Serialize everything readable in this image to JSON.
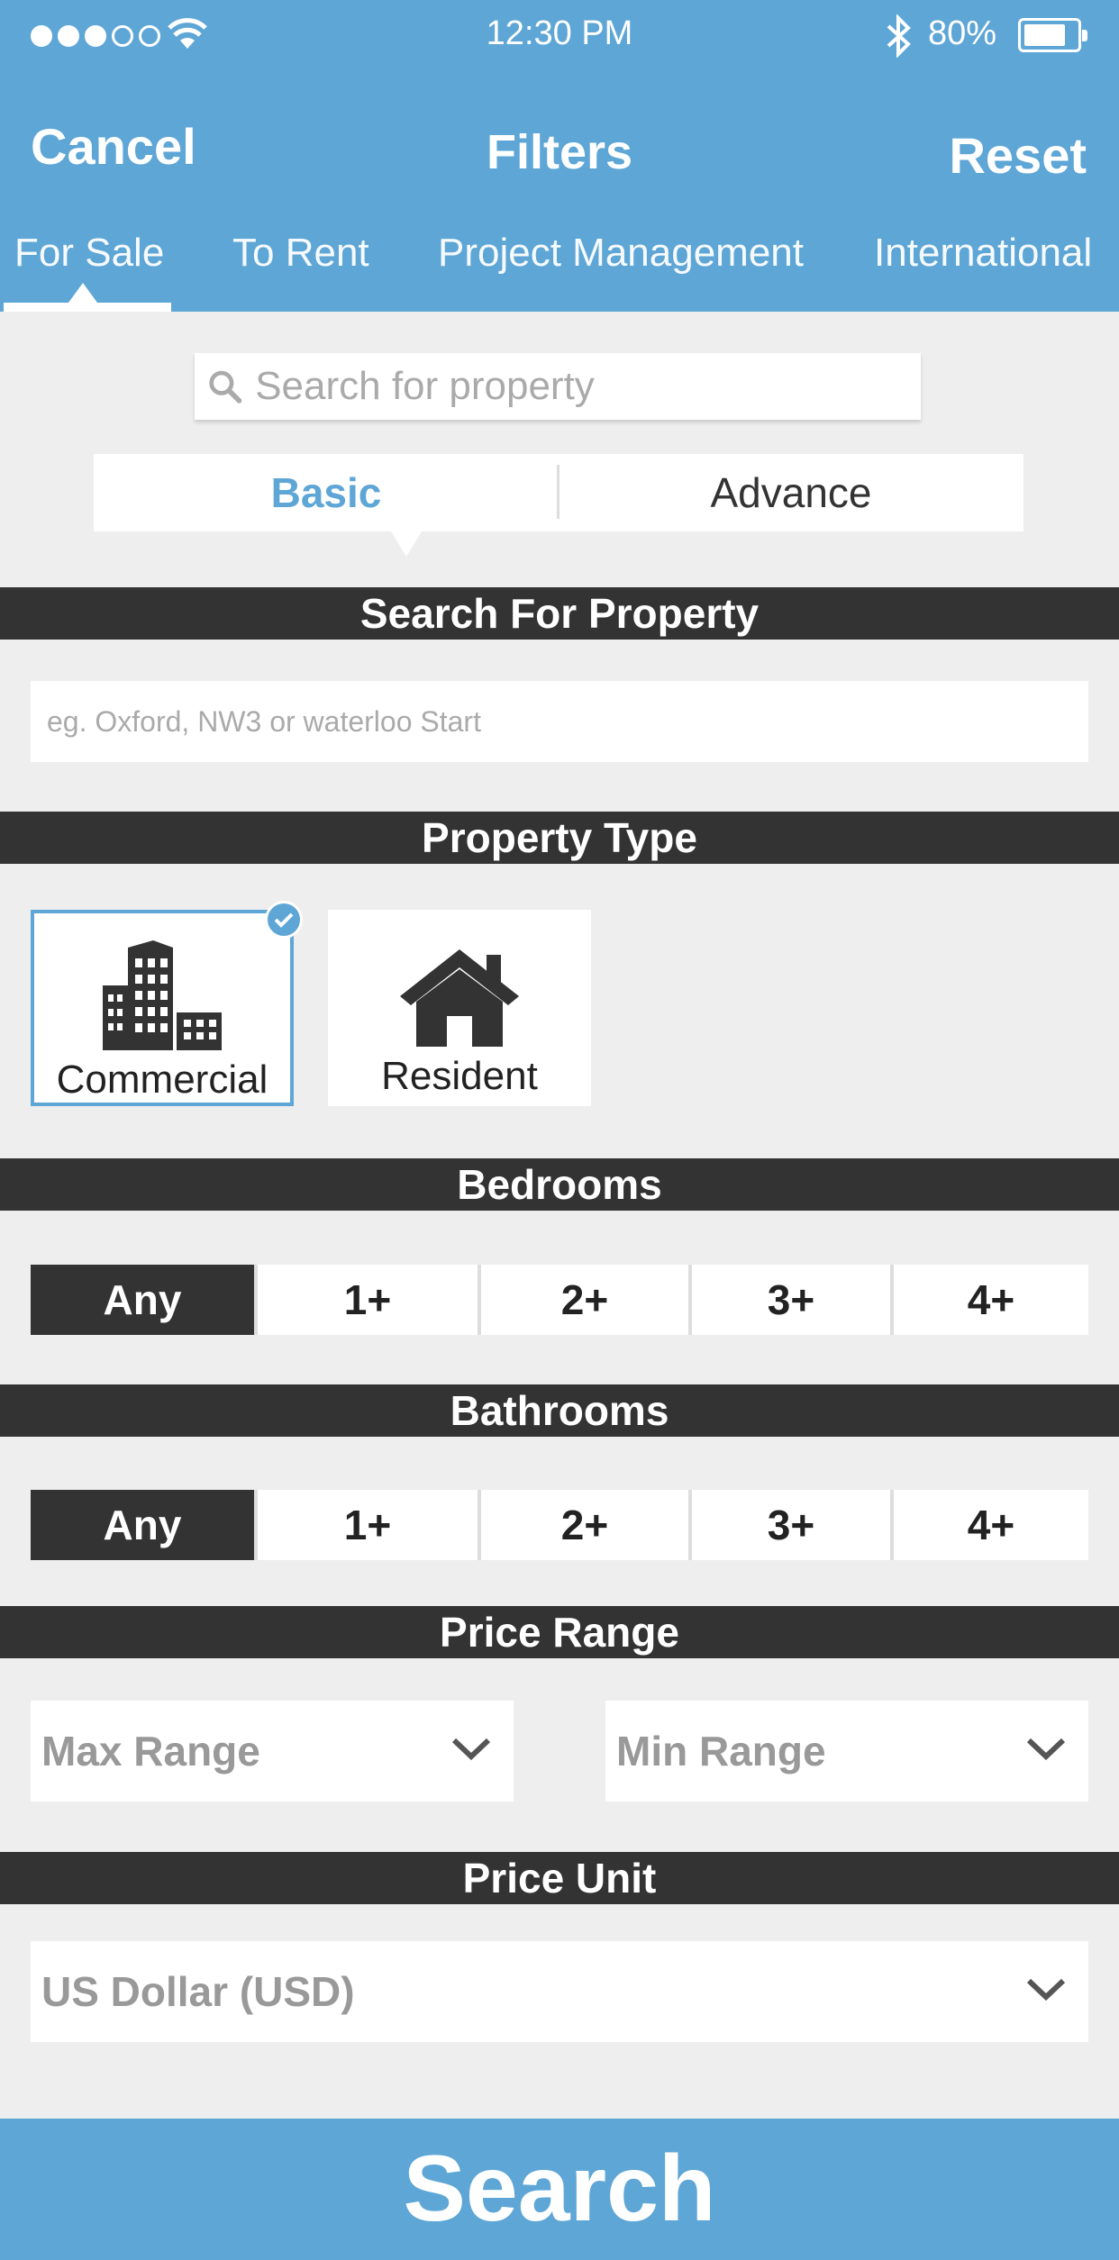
{
  "status_bar": {
    "time": "12:30 PM",
    "battery_percent": "80%",
    "battery_level": 0.8,
    "signal_bars_filled": 3,
    "signal_bars_total": 5
  },
  "nav": {
    "cancel_label": "Cancel",
    "title": "Filters",
    "reset_label": "Reset"
  },
  "tabs": [
    {
      "label": "For Sale",
      "active": true
    },
    {
      "label": "To Rent",
      "active": false
    },
    {
      "label": "Project Management",
      "active": false
    },
    {
      "label": "International",
      "active": false
    }
  ],
  "search": {
    "placeholder": "Search for property"
  },
  "mode_toggle": {
    "basic_label": "Basic",
    "advance_label": "Advance",
    "selected": "Basic"
  },
  "sections": {
    "search_for_property": "Search For Property",
    "property_type": "Property Type",
    "bedrooms": "Bedrooms",
    "bathrooms": "Bathrooms",
    "price_range": "Price Range",
    "price_unit": "Price Unit"
  },
  "location_field": {
    "placeholder": "eg. Oxford, NW3 or waterloo Start"
  },
  "property_types": [
    {
      "label": "Commercial",
      "icon": "buildings-icon",
      "selected": true
    },
    {
      "label": "Resident",
      "icon": "house-icon",
      "selected": false
    }
  ],
  "bedrooms": {
    "options": [
      "Any",
      "1+",
      "2+",
      "3+",
      "4+"
    ],
    "selected": "Any"
  },
  "bathrooms": {
    "options": [
      "Any",
      "1+",
      "2+",
      "3+",
      "4+"
    ],
    "selected": "Any"
  },
  "price_range": {
    "max_label": "Max Range",
    "min_label": "Min Range"
  },
  "price_unit": {
    "value": "US Dollar (USD)"
  },
  "search_button_label": "Search",
  "colors": {
    "accent": "#5ea6d6",
    "dark": "#333333",
    "background": "#eeeeee"
  }
}
